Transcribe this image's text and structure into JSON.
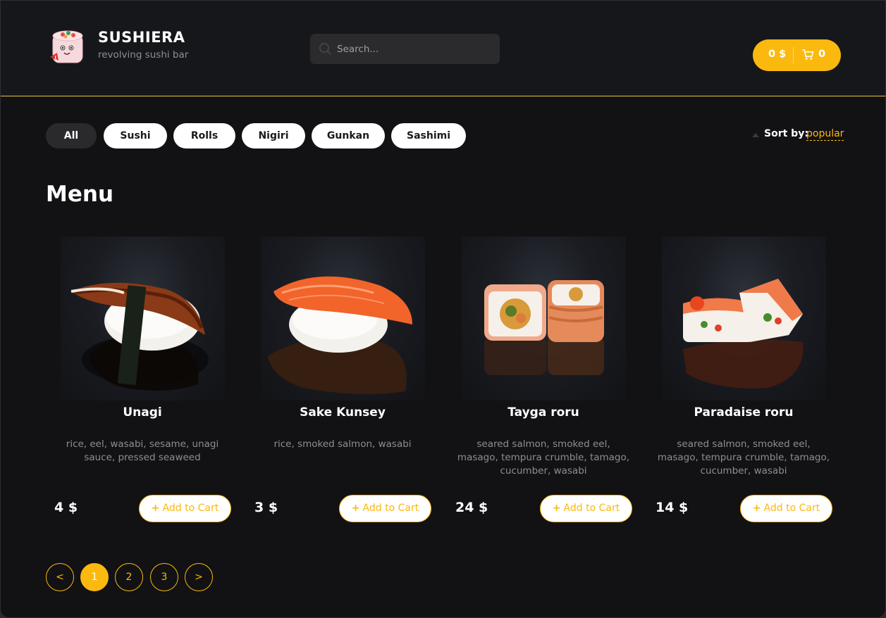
{
  "header": {
    "brand_title": "SUSHIERA",
    "brand_subtitle": "revolving sushi bar",
    "search_placeholder": "Search...",
    "cart_total": "0 $",
    "cart_count": "0"
  },
  "categories": [
    "All",
    "Sushi",
    "Rolls",
    "Nigiri",
    "Gunkan",
    "Sashimi"
  ],
  "active_category": "All",
  "sort": {
    "label": "Sort by:",
    "value": "popular"
  },
  "menu_title": "Menu",
  "products": [
    {
      "name": "Unagi",
      "description": "rice, eel, wasabi, sesame, unagi sauce, pressed seaweed",
      "price": "4 $",
      "button": "Add to Cart"
    },
    {
      "name": "Sake Kunsey",
      "description": "rice, smoked salmon, wasabi",
      "price": "3 $",
      "button": "Add to Cart"
    },
    {
      "name": "Tayga roru",
      "description": "seared salmon, smoked eel, masago, tempura crumble, tamago, cucumber, wasabi",
      "price": "24 $",
      "button": "Add to Cart"
    },
    {
      "name": "Paradaise roru",
      "description": "seared salmon, smoked eel, masago, tempura crumble, tamago, cucumber, wasabi",
      "price": "14 $",
      "button": "Add to Cart"
    }
  ],
  "pagination": {
    "prev": "<",
    "pages": [
      "1",
      "2",
      "3"
    ],
    "next": ">",
    "current": "1"
  },
  "colors": {
    "accent": "#fbb90f",
    "background": "#121214",
    "header": "#16171b",
    "header_border": "#e8c547"
  },
  "icons": [
    "sushi-logo-icon",
    "search-icon",
    "cart-icon",
    "sort-arrow-icon",
    "plus-icon"
  ]
}
